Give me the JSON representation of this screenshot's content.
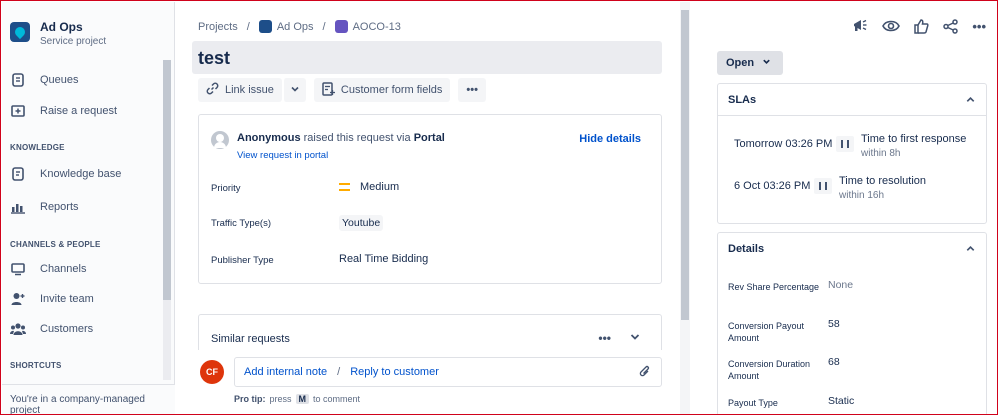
{
  "sidebar": {
    "project_name": "Ad Ops",
    "project_type": "Service project",
    "items": [
      {
        "label": "Queues",
        "icon": "queues-icon"
      },
      {
        "label": "Raise a request",
        "icon": "raise-request-icon"
      },
      {
        "label": "Knowledge base",
        "icon": "knowledge-base-icon"
      },
      {
        "label": "Reports",
        "icon": "reports-icon"
      },
      {
        "label": "Channels",
        "icon": "channels-icon"
      },
      {
        "label": "Invite team",
        "icon": "invite-team-icon"
      },
      {
        "label": "Customers",
        "icon": "customers-icon"
      }
    ],
    "headings": {
      "knowledge": "KNOWLEDGE",
      "channels": "CHANNELS & PEOPLE",
      "shortcuts": "SHORTCUTS"
    },
    "footer": "You're in a company-managed project"
  },
  "breadcrumb": {
    "projects": "Projects",
    "project": "Ad Ops",
    "issue": "AOCO-13"
  },
  "issue": {
    "title": "test",
    "toolbar": {
      "link_issue": "Link issue",
      "customer_form_fields": "Customer form fields",
      "more": "•••"
    },
    "reporter": {
      "name": "Anonymous",
      "action": " raised this request via ",
      "channel": "Portal",
      "view_link": "View request in portal"
    },
    "hide_details": "Hide details",
    "fields": [
      {
        "label": "Priority",
        "value": "Medium"
      },
      {
        "label": "Traffic Type(s)",
        "value": "Youtube"
      },
      {
        "label": "Publisher Type",
        "value": "Real Time Bidding"
      }
    ],
    "similar": {
      "title": "Similar requests",
      "more": "•••"
    },
    "comment": {
      "avatar_initials": "CF",
      "add_note": "Add internal note",
      "separator": "/",
      "reply": "Reply to customer"
    },
    "protip": {
      "prefix": "Pro tip:",
      "text_before": "press",
      "key": "M",
      "text_after": "to comment"
    }
  },
  "right_panel": {
    "status": "Open",
    "slas": {
      "title": "SLAs",
      "items": [
        {
          "time": "Tomorrow 03:26 PM",
          "name": "Time to first response",
          "sub": "within 8h"
        },
        {
          "time": "6 Oct 03:26 PM",
          "name": "Time to resolution",
          "sub": "within 16h"
        }
      ]
    },
    "details": {
      "title": "Details",
      "fields": [
        {
          "label": "Rev Share Percentage",
          "value": "None"
        },
        {
          "label": "Conversion Payout Amount",
          "value": "58"
        },
        {
          "label": "Conversion Duration Amount",
          "value": "68"
        },
        {
          "label": "Payout Type",
          "value": "Static"
        }
      ]
    }
  },
  "colors": {
    "accent": "#0052cc",
    "priority_medium": "#ffab00",
    "avatar_cf": "#de350b",
    "frame": "#d0021b"
  }
}
